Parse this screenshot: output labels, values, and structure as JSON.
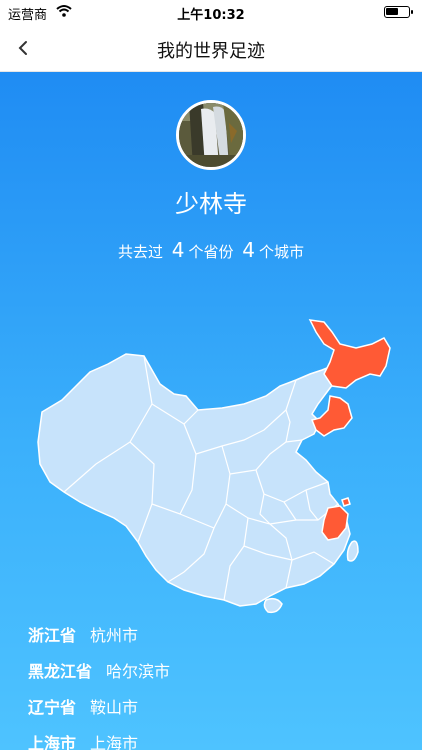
{
  "status_bar": {
    "carrier": "运营商",
    "time": "上午10:32"
  },
  "nav": {
    "title": "我的世界足迹"
  },
  "profile": {
    "name": "少林寺"
  },
  "stats": {
    "prefix": "共去过",
    "province_count": "4",
    "province_unit": "个省份",
    "city_count": "4",
    "city_unit": "个城市"
  },
  "map": {
    "base_color": "#c7e3fb",
    "visited_color": "#ff5a35",
    "border_color": "#ffffff"
  },
  "visited": [
    {
      "province": "浙江省",
      "city": "杭州市"
    },
    {
      "province": "黑龙江省",
      "city": "哈尔滨市"
    },
    {
      "province": "辽宁省",
      "city": "鞍山市"
    },
    {
      "province": "上海市",
      "city": "上海市"
    }
  ]
}
